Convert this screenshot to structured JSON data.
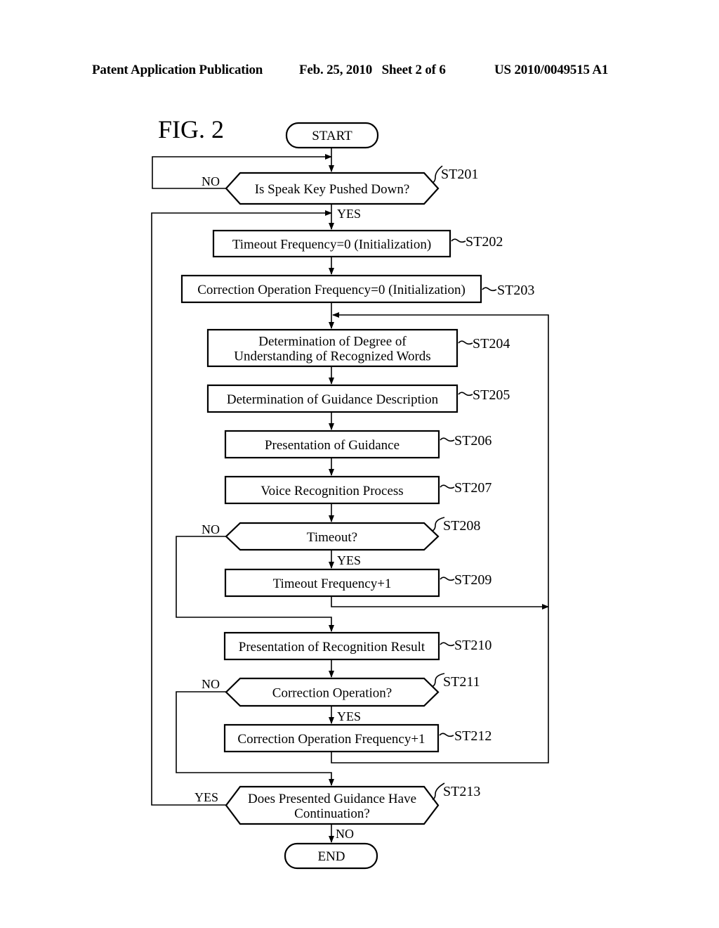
{
  "header": {
    "publication": "Patent Application Publication",
    "date_sheet": "Feb. 25, 2010   Sheet 2 of 6",
    "patent_number": "US 2010/0049515 A1"
  },
  "figure": {
    "label": "FIG. 2",
    "terminals": {
      "start": "START",
      "end": "END"
    },
    "nodes": [
      {
        "id": "ST201",
        "type": "decision",
        "lines": [
          "Is Speak Key Pushed Down?"
        ],
        "yes": "YES",
        "no": "NO"
      },
      {
        "id": "ST202",
        "type": "process",
        "lines": [
          "Timeout Frequency=0 (Initialization)"
        ]
      },
      {
        "id": "ST203",
        "type": "process",
        "lines": [
          "Correction Operation Frequency=0 (Initialization)"
        ]
      },
      {
        "id": "ST204",
        "type": "process",
        "lines": [
          "Determination of Degree of",
          "Understanding of Recognized Words"
        ]
      },
      {
        "id": "ST205",
        "type": "process",
        "lines": [
          "Determination of Guidance Description"
        ]
      },
      {
        "id": "ST206",
        "type": "process",
        "lines": [
          "Presentation of Guidance"
        ]
      },
      {
        "id": "ST207",
        "type": "process",
        "lines": [
          "Voice Recognition Process"
        ]
      },
      {
        "id": "ST208",
        "type": "decision",
        "lines": [
          "Timeout?"
        ],
        "yes": "YES",
        "no": "NO"
      },
      {
        "id": "ST209",
        "type": "process",
        "lines": [
          "Timeout Frequency+1"
        ]
      },
      {
        "id": "ST210",
        "type": "process",
        "lines": [
          "Presentation of Recognition Result"
        ]
      },
      {
        "id": "ST211",
        "type": "decision",
        "lines": [
          "Correction Operation?"
        ],
        "yes": "YES",
        "no": "NO"
      },
      {
        "id": "ST212",
        "type": "process",
        "lines": [
          "Correction Operation Frequency+1"
        ]
      },
      {
        "id": "ST213",
        "type": "decision",
        "lines": [
          "Does Presented Guidance Have",
          "Continuation?"
        ],
        "yes": "YES",
        "no": "NO"
      }
    ]
  }
}
